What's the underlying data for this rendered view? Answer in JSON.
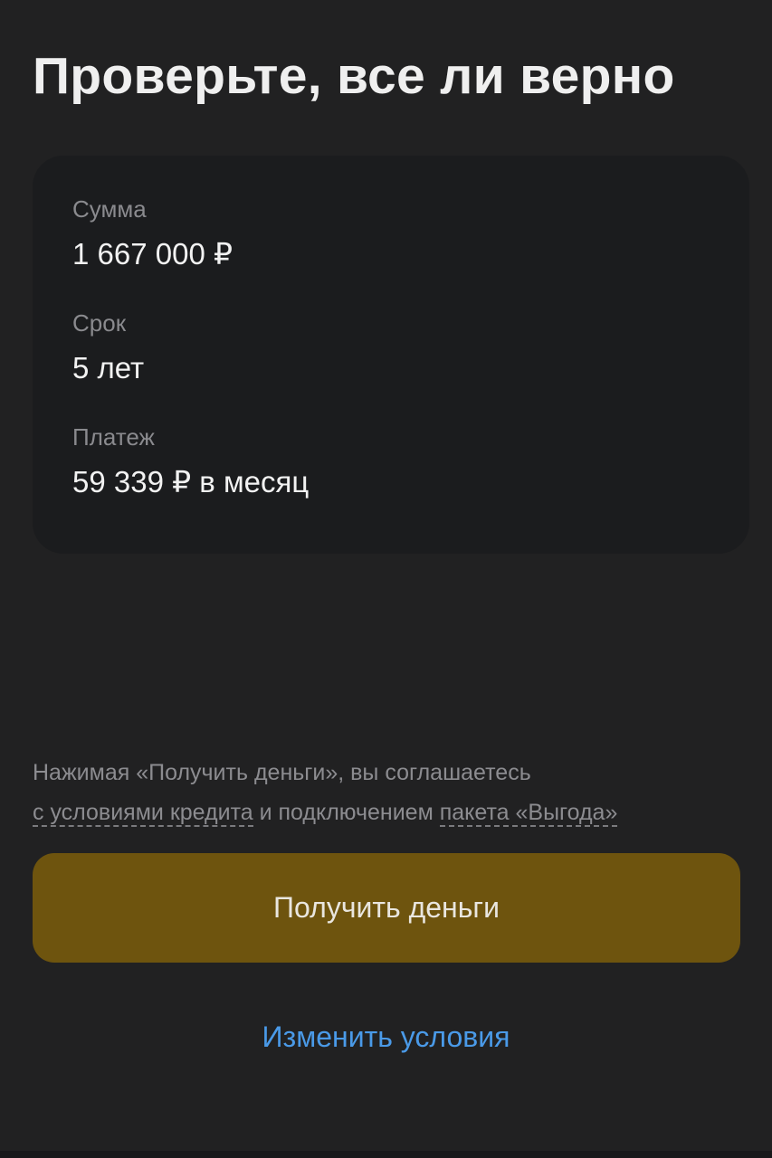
{
  "header": {
    "title": "Проверьте, все ли верно"
  },
  "summary": {
    "amount": {
      "label": "Сумма",
      "value": "1 667 000 ₽"
    },
    "term": {
      "label": "Срок",
      "value": "5 лет"
    },
    "payment": {
      "label": "Платеж",
      "value": "59 339 ₽ в месяц"
    }
  },
  "consent": {
    "prefix": "Нажимая «Получить деньги», вы соглашаетесь ",
    "loan_terms_link": "с условиями кредита",
    "middle": " и подключением ",
    "package_link": "пакета «Выгода»"
  },
  "actions": {
    "primary_label": "Получить деньги",
    "secondary_label": "Изменить условия"
  },
  "colors": {
    "background": "#212122",
    "card": "#1b1c1e",
    "primary_button": "#6e540e",
    "link": "#4a9ae8"
  }
}
